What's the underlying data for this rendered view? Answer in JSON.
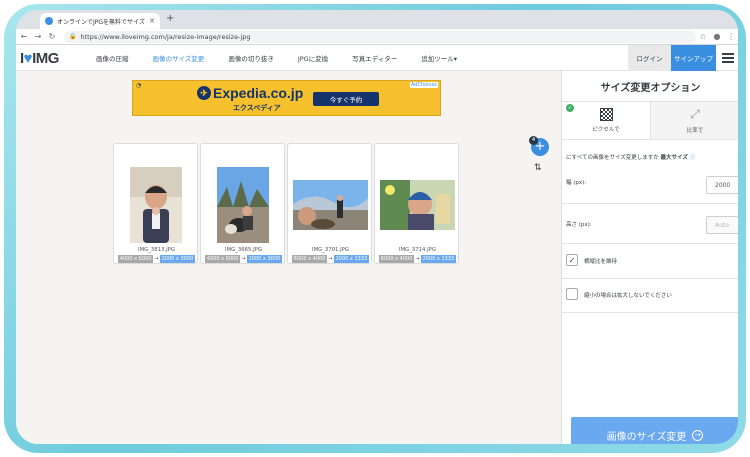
{
  "browser": {
    "tab_title": "オンラインでJPGを無料でサイズ変更",
    "url": "https://www.iloveimg.com/ja/resize-image/resize-jpg"
  },
  "site": {
    "logo_prefix": "I",
    "logo_suffix": "IMG",
    "menu": [
      "画像の圧縮",
      "画像のサイズ変更",
      "画像の切り抜き",
      "JPGに変換",
      "写真エディター",
      "追加ツール▾"
    ],
    "active_menu_index": 1,
    "login": "ログイン",
    "signup": "サインアップ"
  },
  "ad": {
    "brand": "Expedia.co.jp",
    "sub": "エクスペディア",
    "cta": "今すぐ予約",
    "choices": "AdChoices"
  },
  "images": [
    {
      "name": "IMG_3813.JPG",
      "from": "4000 x 6000",
      "to": "2000 x 3000"
    },
    {
      "name": "IMG_3665.JPG",
      "from": "4000 x 6000",
      "to": "2000 x 3000"
    },
    {
      "name": "IMG_3701.JPG",
      "from": "6000 x 4000",
      "to": "2000 x 1333"
    },
    {
      "name": "IMG_3714.JPG",
      "from": "6000 x 4000",
      "to": "2000 x 1333"
    }
  ],
  "add_badge": "4",
  "panel": {
    "title": "サイズ変更オプション",
    "opt_pixels": "ピクセルで",
    "opt_percent": "比率で",
    "question": "にすべての画像をサイズ変更しますか",
    "question_bold": "最大サイズ",
    "width_label": "幅 (px):",
    "width_value": "2000",
    "height_label": "高さ (px):",
    "height_value": "Auto",
    "keep_ratio": "横縦比を維持",
    "no_upscale": "縮小の場合は拡大しないでください",
    "submit": "画像のサイズ変更"
  },
  "colors": {
    "accent": "#3b8fe0",
    "button": "#6aa8ef",
    "ad_bg": "#f7c12d"
  }
}
